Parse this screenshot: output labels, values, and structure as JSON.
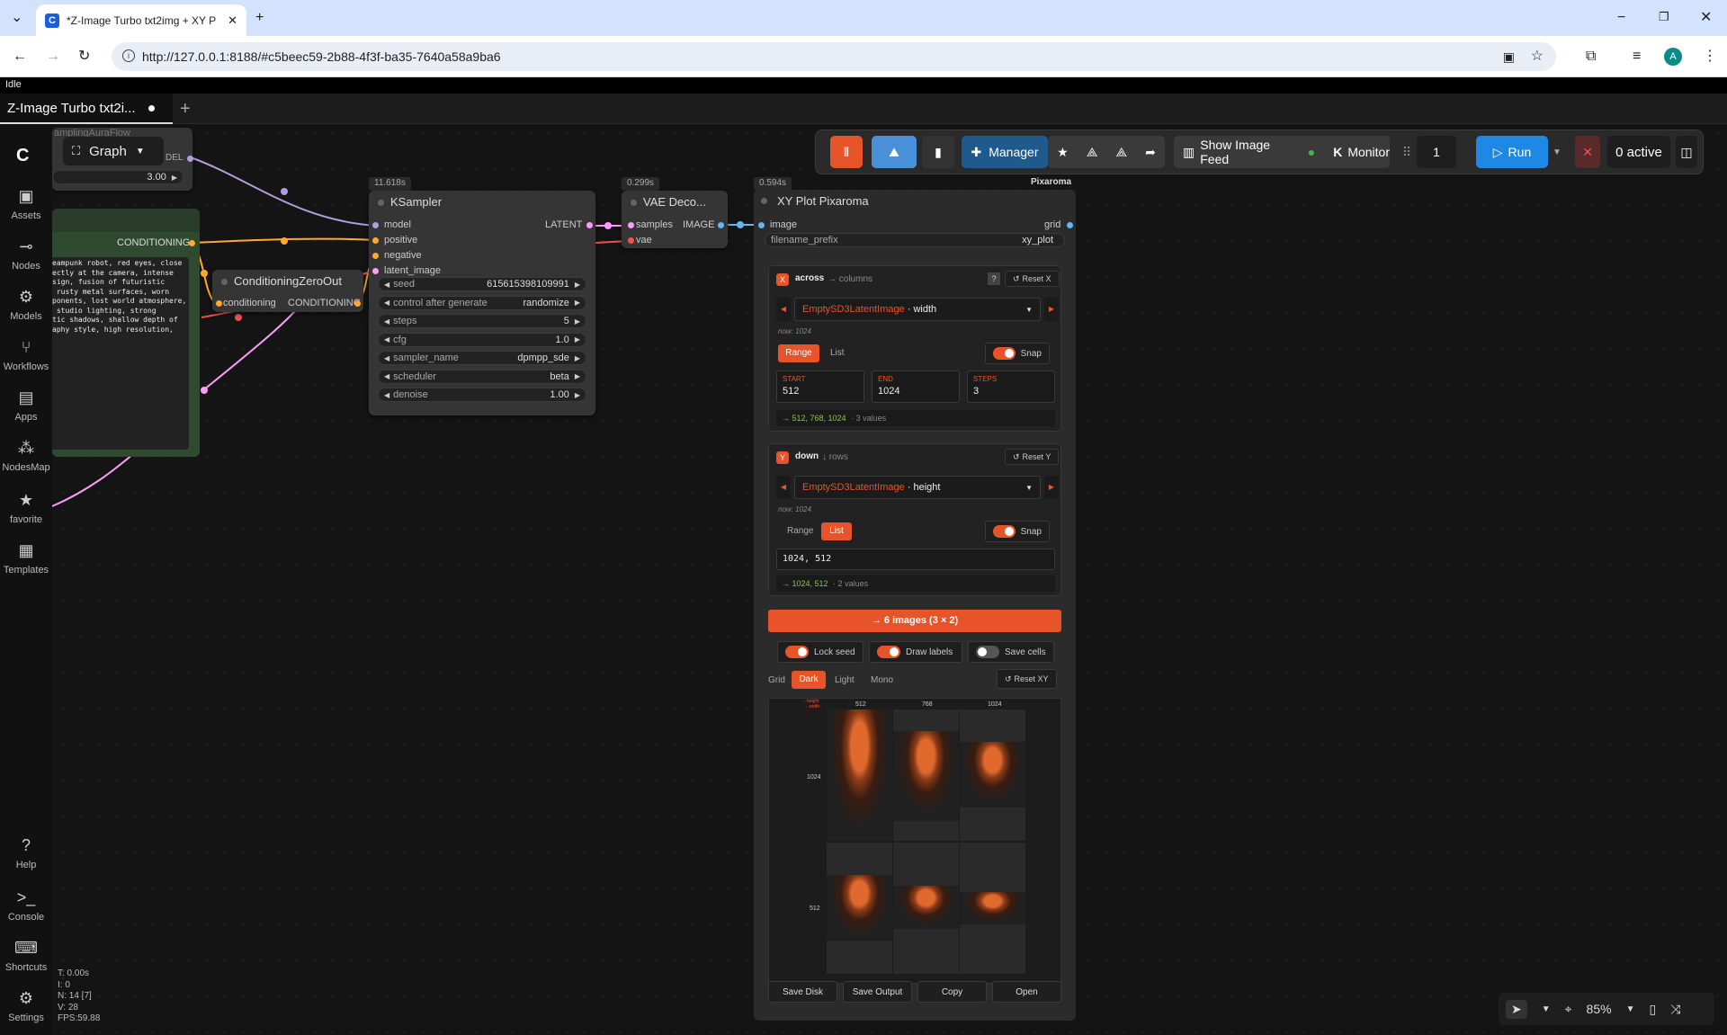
{
  "browser": {
    "tab_title": "*Z-Image Turbo txt2img + XY P",
    "url": "http://127.0.0.1:8188/#c5beec59-2b88-4f3f-ba35-7640a58a9ba6",
    "profile": "A"
  },
  "status": "Idle",
  "workflow_tab": "Z-Image Turbo txt2i...",
  "graph_label": "Graph",
  "sidebar": [
    {
      "label": "Assets",
      "icon": "assets-icon"
    },
    {
      "label": "Nodes",
      "icon": "nodes-icon"
    },
    {
      "label": "Models",
      "icon": "models-icon"
    },
    {
      "label": "Workflows",
      "icon": "workflows-icon"
    },
    {
      "label": "Apps",
      "icon": "apps-icon"
    },
    {
      "label": "NodesMap",
      "icon": "nodesmap-icon"
    },
    {
      "label": "favorite",
      "icon": "star-icon"
    },
    {
      "label": "Templates",
      "icon": "templates-icon"
    },
    {
      "label": "Help",
      "icon": "help-icon"
    },
    {
      "label": "Console",
      "icon": "console-icon"
    },
    {
      "label": "Shortcuts",
      "icon": "keyboard-icon"
    },
    {
      "label": "Settings",
      "icon": "gear-icon"
    }
  ],
  "toolbar": {
    "manager": "Manager",
    "image_feed": "Show Image Feed",
    "monitor": "Monitor",
    "queue_count": "1",
    "run": "Run",
    "active": "0 active"
  },
  "partial_node": {
    "header": "amplingAuraFlow",
    "model_label": "DEL",
    "value": "3.00"
  },
  "prompt_node": {
    "output": "CONDITIONING",
    "text": "eampunk robot, red eyes, close\nectly at the camera, intense\nsign, fusion of futuristic\n rusty metal surfaces, worn\nponents, lost world atmosphere,\n studio lighting, strong\ntic shadows, shallow depth of\naphy style, high resolution,"
  },
  "zero_node": {
    "title": "ConditioningZeroOut",
    "input": "conditioning",
    "output": "CONDITIONING"
  },
  "ksampler": {
    "time": "11.618s",
    "title": "KSampler",
    "inputs": [
      "model",
      "positive",
      "negative",
      "latent_image"
    ],
    "output": "LATENT",
    "widgets": [
      {
        "label": "seed",
        "value": "615615398109991"
      },
      {
        "label": "control after generate",
        "value": "randomize"
      },
      {
        "label": "steps",
        "value": "5"
      },
      {
        "label": "cfg",
        "value": "1.0"
      },
      {
        "label": "sampler_name",
        "value": "dpmpp_sde"
      },
      {
        "label": "scheduler",
        "value": "beta"
      },
      {
        "label": "denoise",
        "value": "1.00"
      }
    ]
  },
  "vae": {
    "time": "0.299s",
    "title": "VAE Deco...",
    "in1": "samples",
    "in2": "vae",
    "output": "IMAGE"
  },
  "xy": {
    "time": "0.594s",
    "brand": "Pixaroma",
    "title": "XY Plot Pixaroma",
    "input": "image",
    "output": "grid",
    "filename_label": "filename_prefix",
    "filename_value": "xy_plot",
    "x": {
      "badge": "X",
      "label": "across",
      "dir": "→ columns",
      "help": "?",
      "reset": "Reset X",
      "node": "EmptySD3LatentImage",
      "field": "· width",
      "now": "now: 1024",
      "mode_range": "Range",
      "mode_list": "List",
      "snap": "Snap",
      "start_k": "START",
      "start_v": "512",
      "end_k": "END",
      "end_v": "1024",
      "steps_k": "STEPS",
      "steps_v": "3",
      "result": "→ 512, 768, 1024",
      "count": "· 3 values"
    },
    "y": {
      "badge": "Y",
      "label": "down",
      "dir": "↓ rows",
      "reset": "Reset Y",
      "node": "EmptySD3LatentImage",
      "field": "· height",
      "now": "now: 1024",
      "mode_range": "Range",
      "mode_list": "List",
      "snap": "Snap",
      "list_value": "1024, 512",
      "result": "→ 1024, 512",
      "count": "· 2 values"
    },
    "generate": "→ 6 images (3 × 2)",
    "lock_seed": "Lock seed",
    "draw_labels": "Draw labels",
    "save_cells": "Save cells",
    "grid_label": "Grid",
    "themes": [
      "Dark",
      "Light",
      "Mono"
    ],
    "reset_xy": "Reset XY",
    "preview": {
      "corner1": "↓ height",
      "corner2": "→ width",
      "cols": [
        "512",
        "768",
        "1024"
      ],
      "rows": [
        "1024",
        "512"
      ]
    },
    "buttons": [
      "Save Disk",
      "Save Output",
      "Copy",
      "Open"
    ]
  },
  "stats": [
    "T: 0.00s",
    "I: 0",
    "N: 14 [7]",
    "V: 28",
    "FPS:59.88"
  ],
  "zoom": "85%",
  "colors": {
    "accent": "#e8542a",
    "run": "#1e88e5",
    "link_model": "#b39ddb",
    "link_cond": "#ffa931",
    "link_latent": "#ff9cf9",
    "link_image": "#64b5f6"
  }
}
